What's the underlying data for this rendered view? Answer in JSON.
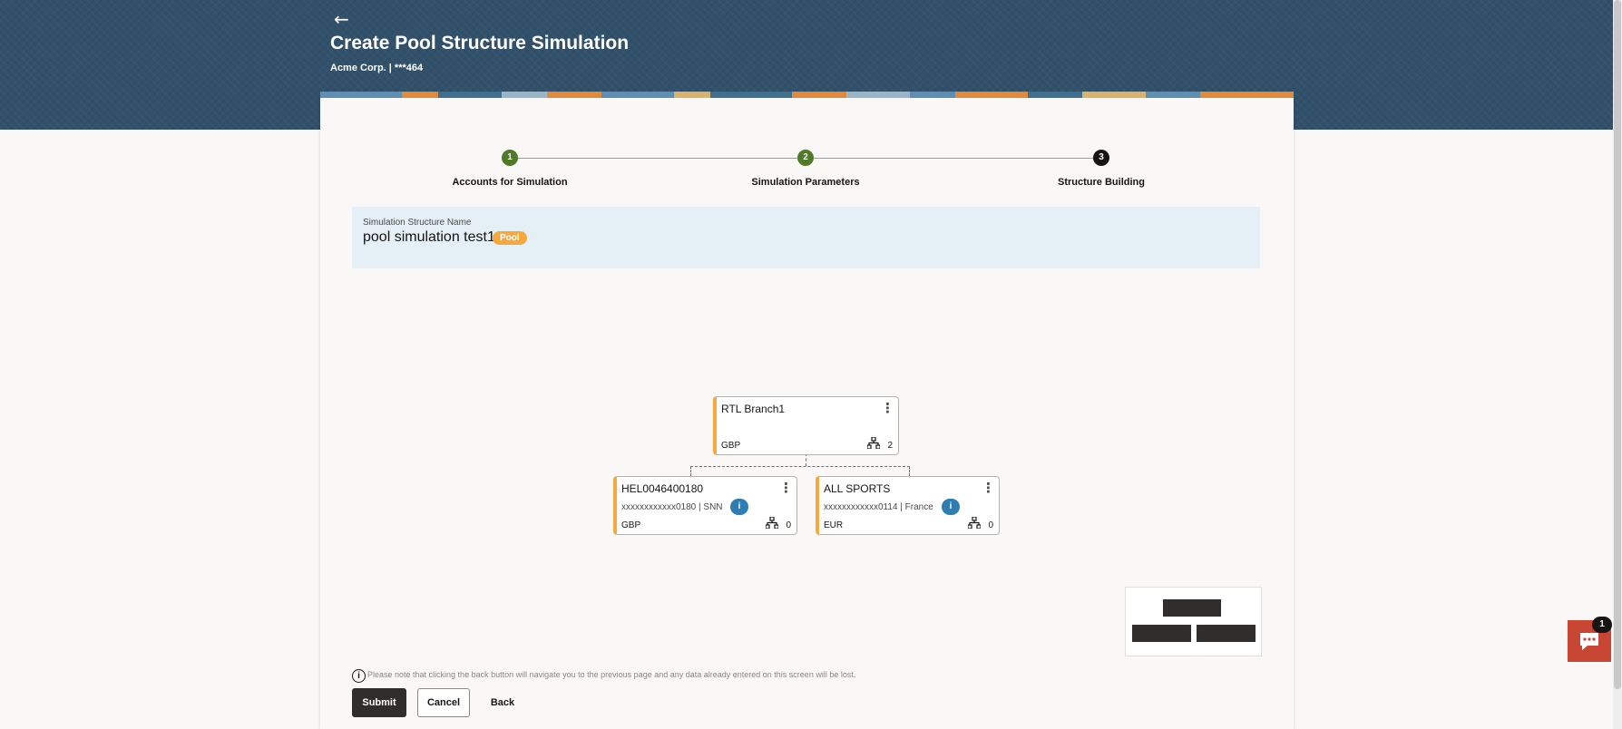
{
  "header": {
    "back_icon": "arrow-left-icon",
    "title": "Create Pool Structure Simulation",
    "subtitle": "Acme Corp. | ***464",
    "brand_color": "#31506a"
  },
  "stepper": {
    "steps": [
      {
        "number": "1",
        "label": "Accounts for Simulation",
        "status": "done"
      },
      {
        "number": "2",
        "label": "Simulation Parameters",
        "status": "done"
      },
      {
        "number": "3",
        "label": "Structure Building",
        "status": "current"
      }
    ],
    "done_color": "#4f7a28",
    "current_color": "#161513"
  },
  "structure": {
    "name_label": "Simulation Structure Name",
    "name": "pool simulation test1",
    "type_badge": "Pool",
    "badge_color": "#f5a93c"
  },
  "tree": {
    "root": {
      "title": "RTL Branch1",
      "currency": "GBP",
      "children_count": "2"
    },
    "children": [
      {
        "title": "HEL0046400180",
        "account": "xxxxxxxxxxxx0180 | SNN",
        "currency": "GBP",
        "children_count": "0",
        "info_label": "i"
      },
      {
        "title": "ALL SPORTS",
        "account": "xxxxxxxxxxxx0114 | France",
        "currency": "EUR",
        "children_count": "0",
        "info_label": "i"
      }
    ]
  },
  "notice": {
    "icon": "info-icon",
    "icon_glyph": "i",
    "text": "Please note that clicking the back button will navigate you to the previous page and any data already entered on this screen will be lost."
  },
  "actions": {
    "submit": "Submit",
    "cancel": "Cancel",
    "back": "Back"
  },
  "chat": {
    "icon": "chat-icon",
    "badge": "1",
    "color": "#c74634"
  }
}
